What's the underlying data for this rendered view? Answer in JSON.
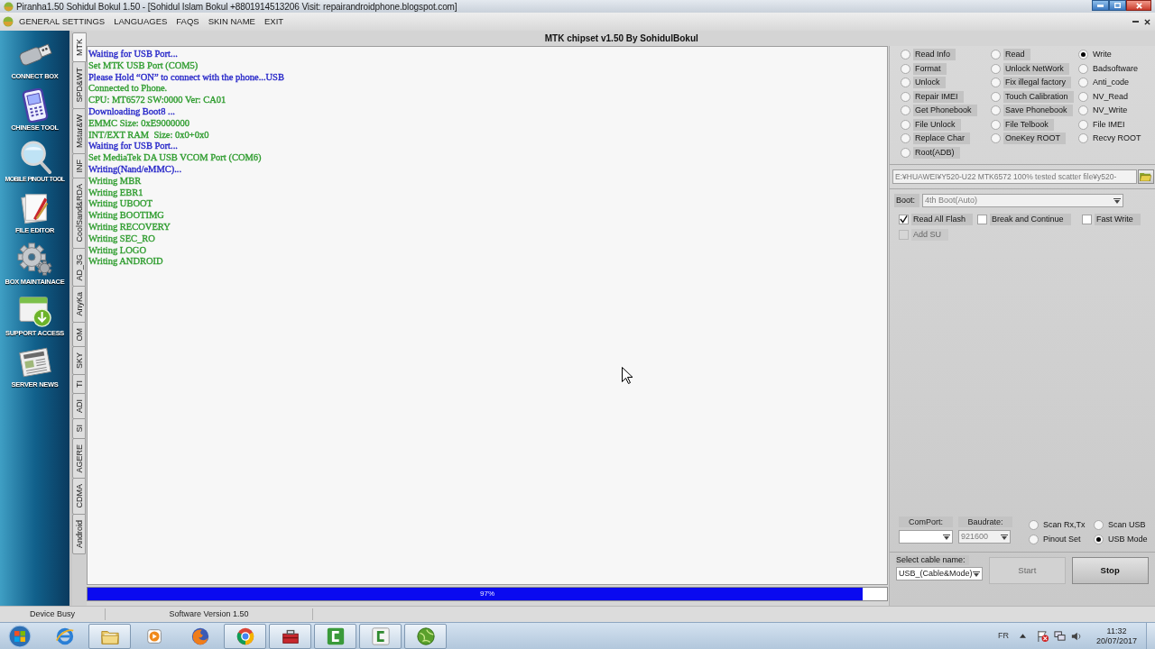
{
  "window": {
    "title": "Piranha1.50 Sohidul Bokul 1.50 - [Sohidul Islam Bokul +8801914513206 Visit: repairandroidphone.blogspot.com]"
  },
  "menu": [
    "GENERAL SETTINGS",
    "LANGUAGES",
    "FAQS",
    "SKIN NAME",
    "EXIT"
  ],
  "sidebar": {
    "items": [
      "CONNECT BOX",
      "CHINESE TOOL",
      "MOBILE PINOUT TOOL",
      "FILE EDITOR",
      "BOX MAINTAINACE",
      "SUPPORT ACCESS",
      "SERVER NEWS"
    ]
  },
  "chip_tabs": [
    {
      "label": "MTK",
      "selected": true
    },
    {
      "label": "SPD&WT",
      "selected": false
    },
    {
      "label": "Mstar&W",
      "selected": false
    },
    {
      "label": "INF",
      "selected": false
    },
    {
      "label": "CoolSand&RDA",
      "selected": false
    },
    {
      "label": "AD_3G",
      "selected": false
    },
    {
      "label": "AnyKa",
      "selected": false
    },
    {
      "label": "OM",
      "selected": false
    },
    {
      "label": "SKY",
      "selected": false
    },
    {
      "label": "TI",
      "selected": false
    },
    {
      "label": "ADI",
      "selected": false
    },
    {
      "label": "SI",
      "selected": false
    },
    {
      "label": "AGERE",
      "selected": false
    },
    {
      "label": "CDMA",
      "selected": false
    },
    {
      "label": "Android",
      "selected": false
    }
  ],
  "panel_title": "MTK chipset v1.50 By SohidulBokul",
  "log": [
    {
      "text": "Waiting for USB Port...",
      "color": "#2424c8"
    },
    {
      "text": "Set MTK USB Port (COM5)",
      "color": "#2e9c2e"
    },
    {
      "text": "Please Hold “ON” to connect with the phone...USB",
      "color": "#2424c8"
    },
    {
      "text": "Connected to Phone.",
      "color": "#2e9c2e"
    },
    {
      "text": "CPU: MT6572 SW:0000 Ver: CA01",
      "color": "#2e9c2e"
    },
    {
      "text": "Downloading Boot8 ...",
      "color": "#2424c8"
    },
    {
      "text": "EMMC Size: 0xE9000000",
      "color": "#2e9c2e"
    },
    {
      "text": "INT/EXT RAM  Size: 0x0+0x0",
      "color": "#2e9c2e"
    },
    {
      "text": "Waiting for USB Port...",
      "color": "#2424c8"
    },
    {
      "text": "Set MediaTek DA USB VCOM Port (COM6)",
      "color": "#2e9c2e"
    },
    {
      "text": "Writing(Nand/eMMC)...",
      "color": "#2424c8"
    },
    {
      "text": "Writing MBR",
      "color": "#2e9c2e"
    },
    {
      "text": "Writing EBR1",
      "color": "#2e9c2e"
    },
    {
      "text": "Writing UBOOT",
      "color": "#2e9c2e"
    },
    {
      "text": "Writing BOOTIMG",
      "color": "#2e9c2e"
    },
    {
      "text": "Writing RECOVERY",
      "color": "#2e9c2e"
    },
    {
      "text": "Writing SEC_RO",
      "color": "#2e9c2e"
    },
    {
      "text": "Writing LOGO",
      "color": "#2e9c2e"
    },
    {
      "text": "Writing ANDROID",
      "color": "#2e9c2e"
    }
  ],
  "progress": {
    "level": 0.97,
    "reading": "97%"
  },
  "operations": {
    "columns": [
      [
        {
          "label": "Read Info",
          "selected": false
        },
        {
          "label": "Format",
          "selected": false
        },
        {
          "label": "Unlock",
          "selected": false
        },
        {
          "label": "Repair IMEI",
          "selected": false
        },
        {
          "label": "Get Phonebook",
          "selected": false
        },
        {
          "label": "File Unlock",
          "selected": false
        },
        {
          "label": "Replace Char",
          "selected": false
        },
        {
          "label": "Root(ADB)",
          "selected": false
        }
      ],
      [
        {
          "label": "Read",
          "selected": false
        },
        {
          "label": "Unlock NetWork",
          "selected": false
        },
        {
          "label": "Fix illegal factory",
          "selected": false
        },
        {
          "label": "Touch Calibration",
          "selected": false
        },
        {
          "label": "Save Phonebook",
          "selected": false
        },
        {
          "label": "File Telbook",
          "selected": false
        },
        {
          "label": "OneKey ROOT",
          "selected": false
        }
      ],
      [
        {
          "label": "Write",
          "selected": true
        },
        {
          "label": "Badsoftware",
          "selected": false
        },
        {
          "label": "Anti_code",
          "selected": false
        },
        {
          "label": "NV_Read",
          "selected": false
        },
        {
          "label": "NV_Write",
          "selected": false
        },
        {
          "label": "File IMEI",
          "selected": false
        },
        {
          "label": "Recvy ROOT",
          "selected": false
        }
      ]
    ]
  },
  "scatter_file": {
    "value": "E:¥HUAWEI¥Y520-U22 MTK6572 100% tested scatter file¥y520-",
    "disabled": true
  },
  "boot": {
    "label": "Boot:",
    "value": "4th Boot(Auto)",
    "disabled": true
  },
  "options": [
    {
      "label": "Read All Flash",
      "checked": true,
      "disabled": false
    },
    {
      "label": "Break and Continue",
      "checked": false,
      "disabled": false
    },
    {
      "label": "Fast Write",
      "checked": false,
      "disabled": false
    },
    {
      "label": "Add SU",
      "checked": false,
      "disabled": true
    }
  ],
  "comport": {
    "label": "ComPort:",
    "disabled": false
  },
  "baudrate": {
    "label": "Baudrate:",
    "value": "921600",
    "disabled": true
  },
  "modes": [
    {
      "label": "Scan Rx,Tx",
      "selected": false
    },
    {
      "label": "Scan USB",
      "selected": false
    },
    {
      "label": "Pinout Set",
      "selected": false
    },
    {
      "label": "USB Mode",
      "selected": true
    }
  ],
  "cable": {
    "label": "Select cable name:",
    "value": "USB_(Cable&Mode)",
    "disabled": false
  },
  "buttons": [
    {
      "label": "Start",
      "disabled": true
    },
    {
      "label": "Stop",
      "disabled": false
    }
  ],
  "status_bar": [
    "Device Busy",
    "Software Version 1.50"
  ],
  "taskbar": {
    "apps": [
      {
        "running": false
      },
      {
        "running": true
      },
      {
        "running": false
      },
      {
        "running": false
      },
      {
        "running": true
      },
      {
        "running": true
      },
      {
        "running": true
      },
      {
        "running": true
      },
      {
        "running": true
      }
    ],
    "language": "FR",
    "time": "11:32",
    "date": "20/07/2017"
  }
}
